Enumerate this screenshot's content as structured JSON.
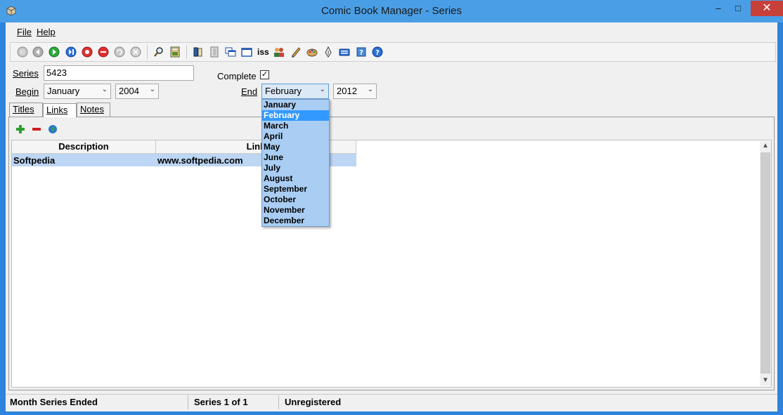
{
  "window": {
    "title": "Comic Book Manager - Series",
    "min_glyph": "–",
    "max_glyph": "□",
    "close_glyph": "✕"
  },
  "menu": {
    "file": "File",
    "help": "Help"
  },
  "toolbar": {
    "iss_label": "iss"
  },
  "form": {
    "series_label": "Series",
    "series_value": "5423",
    "complete_label": "Complete",
    "complete_checked": "✓",
    "begin_label": "Begin",
    "begin_month": "January",
    "begin_year": "2004",
    "end_label": "End",
    "end_month": "February",
    "end_year": "2012"
  },
  "tabs": {
    "titles": "Titles",
    "links": "Links",
    "notes": "Notes"
  },
  "grid": {
    "columns": [
      "Description",
      "Link"
    ],
    "rows": [
      {
        "description": "Softpedia",
        "link": "www.softpedia.com"
      }
    ]
  },
  "dropdown": {
    "items": [
      "January",
      "February",
      "March",
      "April",
      "May",
      "June",
      "July",
      "August",
      "September",
      "October",
      "November",
      "December"
    ],
    "selected": "February"
  },
  "status": {
    "field1": "Month Series Ended",
    "field2": "Series 1 of 1",
    "field3": "Unregistered"
  },
  "colors": {
    "accent": "#4a9ee6",
    "selection": "#3399ff",
    "row_highlight": "#bcd6f4"
  }
}
